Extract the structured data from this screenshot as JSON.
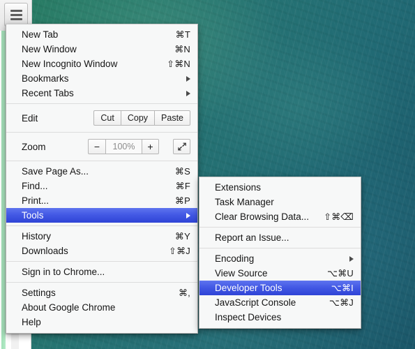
{
  "window": {
    "hamburger_button_label": "Chrome menu"
  },
  "main_menu": {
    "groups": [
      {
        "items": [
          {
            "label": "New Tab",
            "accel": "⌘T",
            "submenu": false,
            "highlighted": false
          },
          {
            "label": "New Window",
            "accel": "⌘N",
            "submenu": false,
            "highlighted": false
          },
          {
            "label": "New Incognito Window",
            "accel": "⇧⌘N",
            "submenu": false,
            "highlighted": false
          },
          {
            "label": "Bookmarks",
            "accel": "",
            "submenu": true,
            "highlighted": false
          },
          {
            "label": "Recent Tabs",
            "accel": "",
            "submenu": true,
            "highlighted": false
          }
        ]
      }
    ],
    "edit_row": {
      "label": "Edit",
      "buttons": [
        "Cut",
        "Copy",
        "Paste"
      ]
    },
    "zoom_row": {
      "label": "Zoom",
      "minus": "−",
      "value": "100%",
      "plus": "+",
      "fullscreen_icon": "fullscreen-icon"
    },
    "group_file": [
      {
        "label": "Save Page As...",
        "accel": "⌘S",
        "submenu": false,
        "highlighted": false
      },
      {
        "label": "Find...",
        "accel": "⌘F",
        "submenu": false,
        "highlighted": false
      },
      {
        "label": "Print...",
        "accel": "⌘P",
        "submenu": false,
        "highlighted": false
      },
      {
        "label": "Tools",
        "accel": "",
        "submenu": true,
        "highlighted": true
      }
    ],
    "group_history": [
      {
        "label": "History",
        "accel": "⌘Y",
        "submenu": false,
        "highlighted": false
      },
      {
        "label": "Downloads",
        "accel": "⇧⌘J",
        "submenu": false,
        "highlighted": false
      }
    ],
    "group_signin": [
      {
        "label": "Sign in to Chrome...",
        "accel": "",
        "submenu": false,
        "highlighted": false
      }
    ],
    "group_settings": [
      {
        "label": "Settings",
        "accel": "⌘,",
        "submenu": false,
        "highlighted": false
      },
      {
        "label": "About Google Chrome",
        "accel": "",
        "submenu": false,
        "highlighted": false
      },
      {
        "label": "Help",
        "accel": "",
        "submenu": false,
        "highlighted": false
      }
    ]
  },
  "tools_submenu": {
    "group_a": [
      {
        "label": "Extensions",
        "accel": "",
        "submenu": false,
        "highlighted": false
      },
      {
        "label": "Task Manager",
        "accel": "",
        "submenu": false,
        "highlighted": false
      },
      {
        "label": "Clear Browsing Data...",
        "accel": "⇧⌘⌫",
        "submenu": false,
        "highlighted": false
      }
    ],
    "group_b": [
      {
        "label": "Report an Issue...",
        "accel": "",
        "submenu": false,
        "highlighted": false
      }
    ],
    "group_c": [
      {
        "label": "Encoding",
        "accel": "",
        "submenu": true,
        "highlighted": false
      },
      {
        "label": "View Source",
        "accel": "⌥⌘U",
        "submenu": false,
        "highlighted": false
      },
      {
        "label": "Developer Tools",
        "accel": "⌥⌘I",
        "submenu": false,
        "highlighted": true
      },
      {
        "label": "JavaScript Console",
        "accel": "⌥⌘J",
        "submenu": false,
        "highlighted": false
      },
      {
        "label": "Inspect Devices",
        "accel": "",
        "submenu": false,
        "highlighted": false
      }
    ]
  },
  "colors": {
    "highlight_blue_top": "#5e74ef",
    "highlight_blue_bottom": "#2f44d6",
    "menu_background": "#f7f8f8",
    "menu_border": "#b2b2b2",
    "separator": "#dcdcdc",
    "wallpaper_green": "#2a7d63",
    "wallpaper_teal": "#1a5668",
    "chrome_strip_green": "#b6ebc8"
  }
}
